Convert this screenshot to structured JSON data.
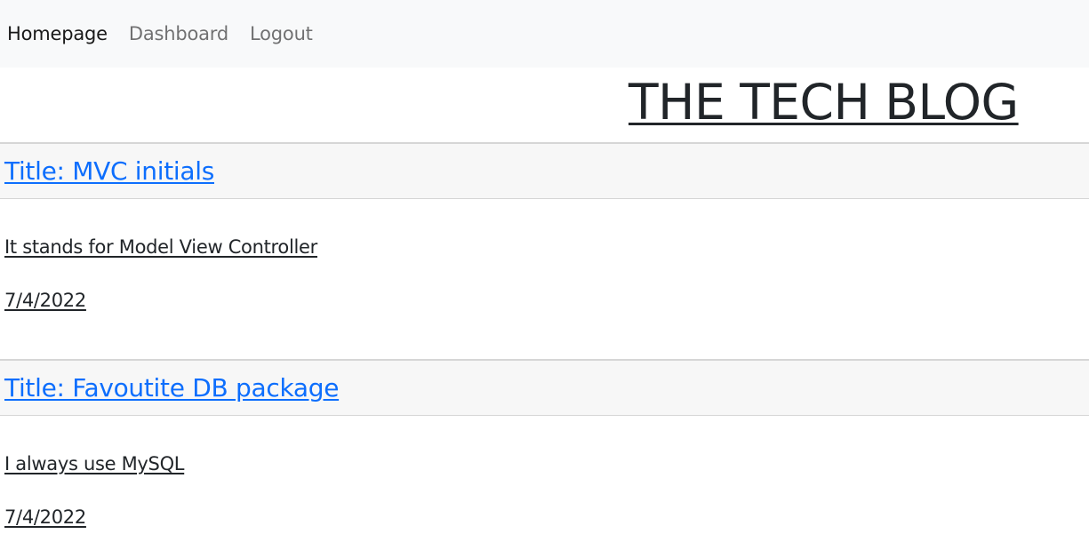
{
  "nav": {
    "items": [
      {
        "label": "Homepage",
        "active": true
      },
      {
        "label": "Dashboard",
        "active": false
      },
      {
        "label": "Logout",
        "active": false
      }
    ]
  },
  "header": {
    "title": "THE TECH BLOG"
  },
  "posts": [
    {
      "title": "Title: MVC initials",
      "content": "It stands for Model View Controller",
      "date": "7/4/2022"
    },
    {
      "title": "Title: Favoutite DB package",
      "content": "I always use MySQL",
      "date": "7/4/2022"
    }
  ],
  "colors": {
    "navbar_bg": "#f8f9fa",
    "post_header_bg": "#f7f7f7",
    "link_blue": "#0d6efd",
    "text_dark": "#212529"
  }
}
